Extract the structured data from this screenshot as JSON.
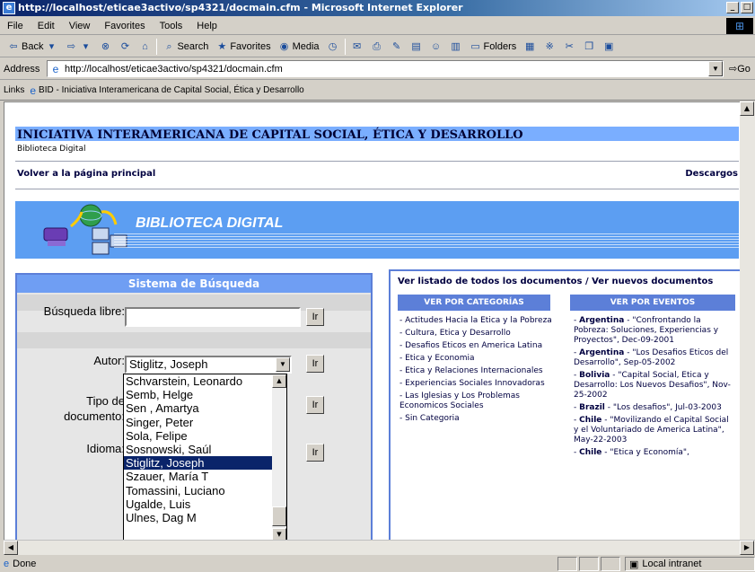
{
  "window": {
    "title": "http://localhost/eticae3activo/sp4321/docmain.cfm - Microsoft Internet Explorer",
    "buttons": [
      "_",
      "8",
      ""
    ]
  },
  "menu": [
    "File",
    "Edit",
    "View",
    "Favorites",
    "Tools",
    "Help"
  ],
  "toolbar": {
    "back": "Back",
    "search": "Search",
    "favorites": "Favorites",
    "media": "Media",
    "folders": "Folders"
  },
  "address": {
    "label": "Address",
    "url": "http://localhost/eticae3activo/sp4321/docmain.cfm",
    "go": "Go"
  },
  "links": {
    "label": "Links",
    "item": "BID - Iniciativa Interamericana de Capital Social, Ética y Desarrollo"
  },
  "page": {
    "title": "INICIATIVA INTERAMERICANA DE CAPITAL SOCIAL, ÉTICA Y DESARROLLO",
    "subtitle": "Biblioteca Digital",
    "nav_home": "Volver a la página principal",
    "nav_downloads": "Descargos",
    "banner_title": "BIBLIOTECA DIGITAL"
  },
  "search": {
    "heading": "Sistema de Búsqueda",
    "free_label": "Búsqueda libre:",
    "free_value": "",
    "author_label": "Autor:",
    "author_value": "Stiglitz, Joseph",
    "doctype_label": "Tipo de documento:",
    "language_label": "Idioma:",
    "go_label": "Ir",
    "author_options": [
      "Schvarstein, Leonardo",
      "Semb, Helge",
      "Sen , Amartya",
      "Singer, Peter",
      "Sola, Felipe",
      "Sosnowski, Saúl",
      "Stiglitz, Joseph",
      "Szauer, María T",
      "Tomassini, Luciano",
      "Ugalde, Luis",
      "Ulnes, Dag M"
    ]
  },
  "right": {
    "links": "Ver listado de todos los documentos / Ver nuevos documentos",
    "categories_head": "VER POR CATEGORÍAS",
    "events_head": "VER POR EVENTOS",
    "categories": [
      "Actitudes Hacia la Etica y la Pobreza",
      "Cultura, Etica y Desarrollo",
      "Desafios Eticos en America Latina",
      "Etica y Economia",
      "Etica y Relaciones Internacionales",
      "Experiencias Sociales Innovadoras",
      "Las Iglesias y Los Problemas Economicos Sociales",
      "Sin Categoria"
    ],
    "events": [
      {
        "country": "Argentina",
        "text": " - \"Confrontando la Pobreza: Soluciones, Experiencias y Proyectos\", Dec-09-2001"
      },
      {
        "country": "Argentina",
        "text": " - \"Los Desafios Eticos del Desarrollo\", Sep-05-2002"
      },
      {
        "country": "Bolivia",
        "text": " - \"Capital Social, Etica y Desarrollo: Los Nuevos Desafios\", Nov-25-2002"
      },
      {
        "country": "Brazil",
        "text": " - \"Los desafios\", Jul-03-2003"
      },
      {
        "country": "Chile",
        "text": " - \"Movilizando el Capital Social y el Voluntariado de America Latina\", May-22-2003"
      },
      {
        "country": "Chile",
        "text": " - \"Etica y Economía\","
      }
    ]
  },
  "status": {
    "text": "Done",
    "zone": "Local intranet"
  }
}
